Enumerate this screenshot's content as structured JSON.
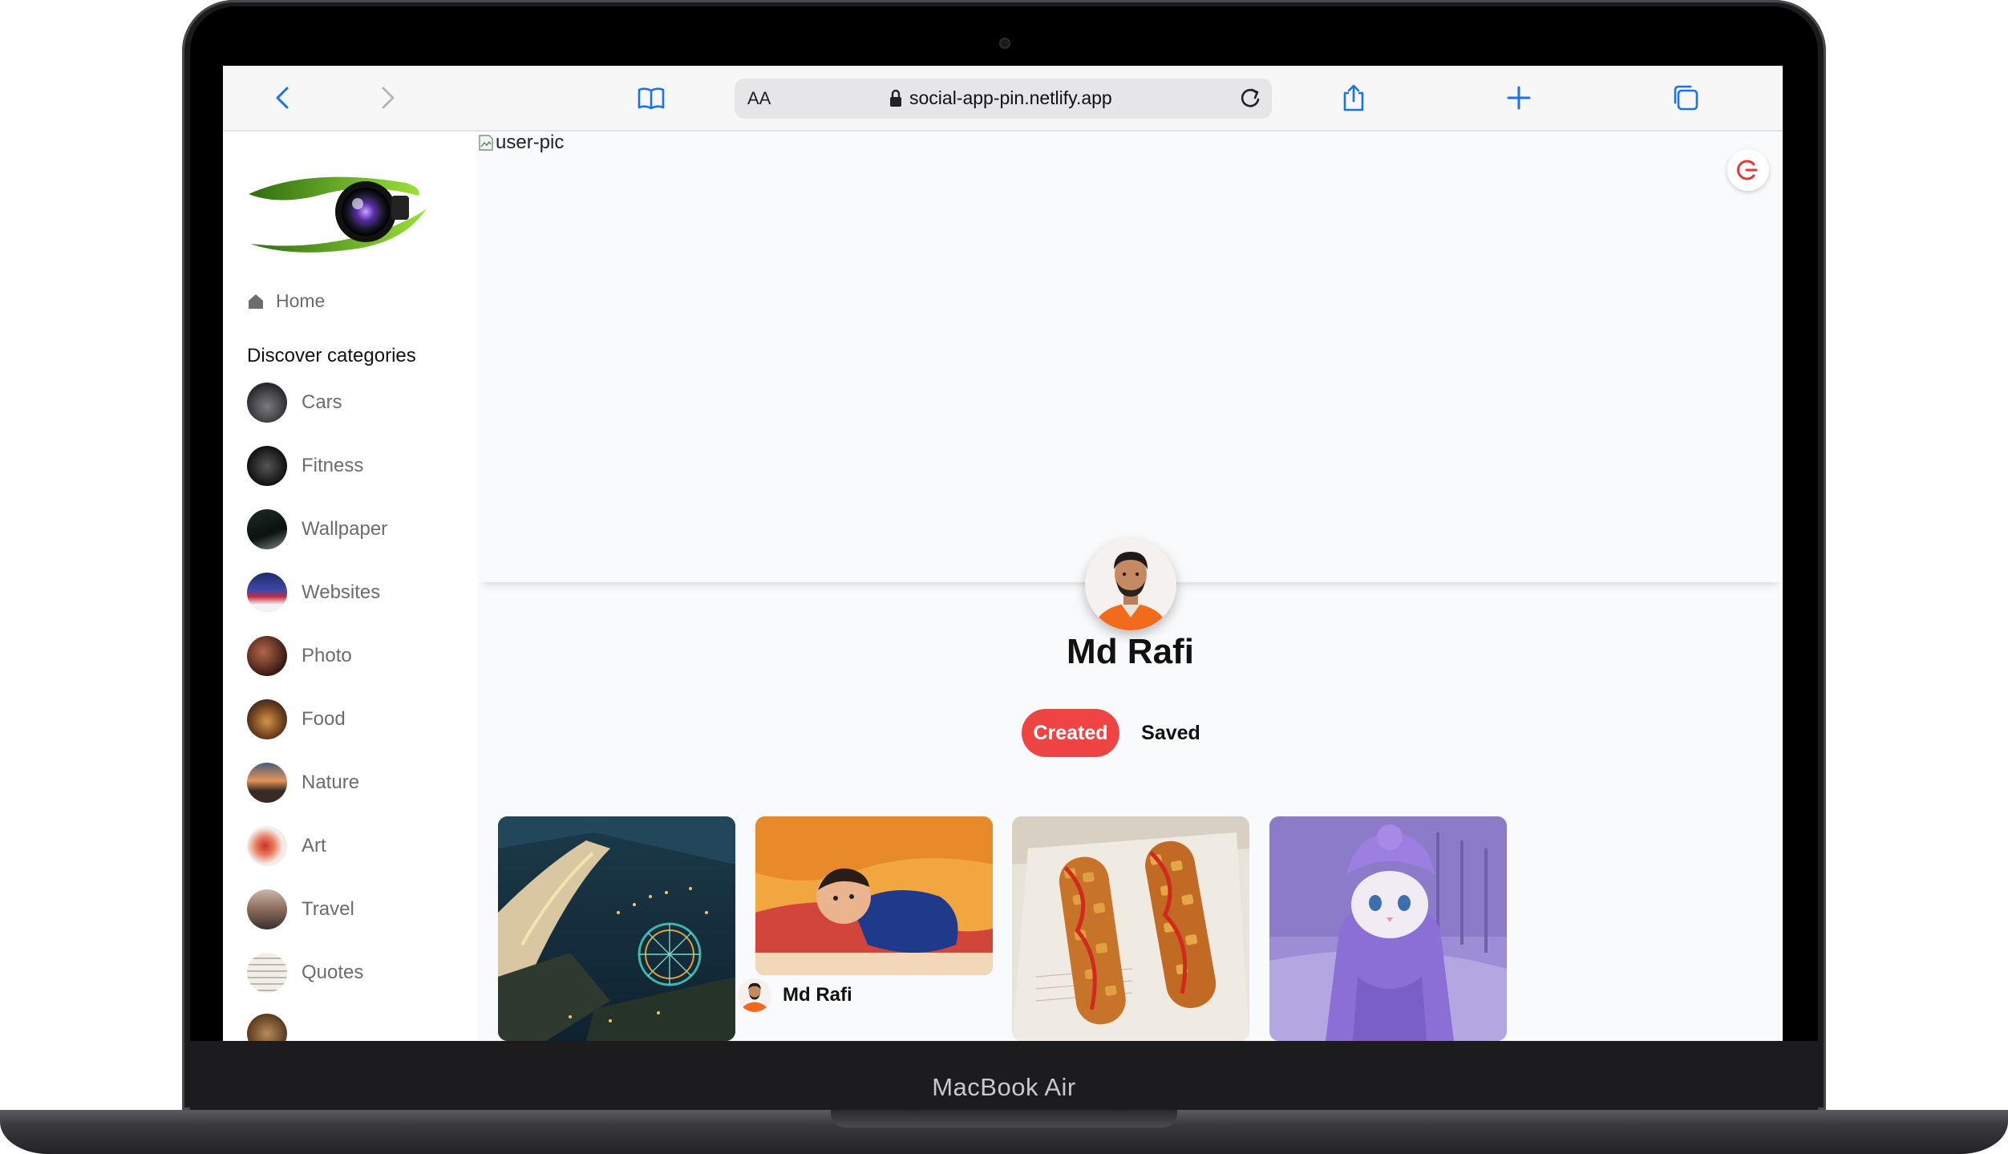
{
  "device": {
    "model_label": "MacBook Air"
  },
  "browser": {
    "aa_label": "AA",
    "url": "social-app-pin.netlify.app",
    "icons": [
      "back-icon",
      "forward-icon",
      "bookmarks-icon",
      "lock-icon",
      "reload-icon",
      "share-icon",
      "new-tab-icon",
      "tabs-icon"
    ]
  },
  "sidebar": {
    "home_label": "Home",
    "discover_heading": "Discover categories",
    "categories": [
      {
        "label": "Cars"
      },
      {
        "label": "Fitness"
      },
      {
        "label": "Wallpaper"
      },
      {
        "label": "Websites"
      },
      {
        "label": "Photo"
      },
      {
        "label": "Food"
      },
      {
        "label": "Nature"
      },
      {
        "label": "Art"
      },
      {
        "label": "Travel"
      },
      {
        "label": "Quotes"
      }
    ]
  },
  "profile": {
    "banner_alt": "user-pic",
    "name": "Md Rafi",
    "tabs": {
      "created": "Created",
      "saved": "Saved"
    },
    "active_tab": "Created",
    "accent_color": "#ef4444"
  },
  "pins": [
    {
      "subject": "city night harbor"
    },
    {
      "subject": "baby",
      "author": "Md Rafi"
    },
    {
      "subject": "corn dogs"
    },
    {
      "subject": "cat in purple robe"
    }
  ]
}
